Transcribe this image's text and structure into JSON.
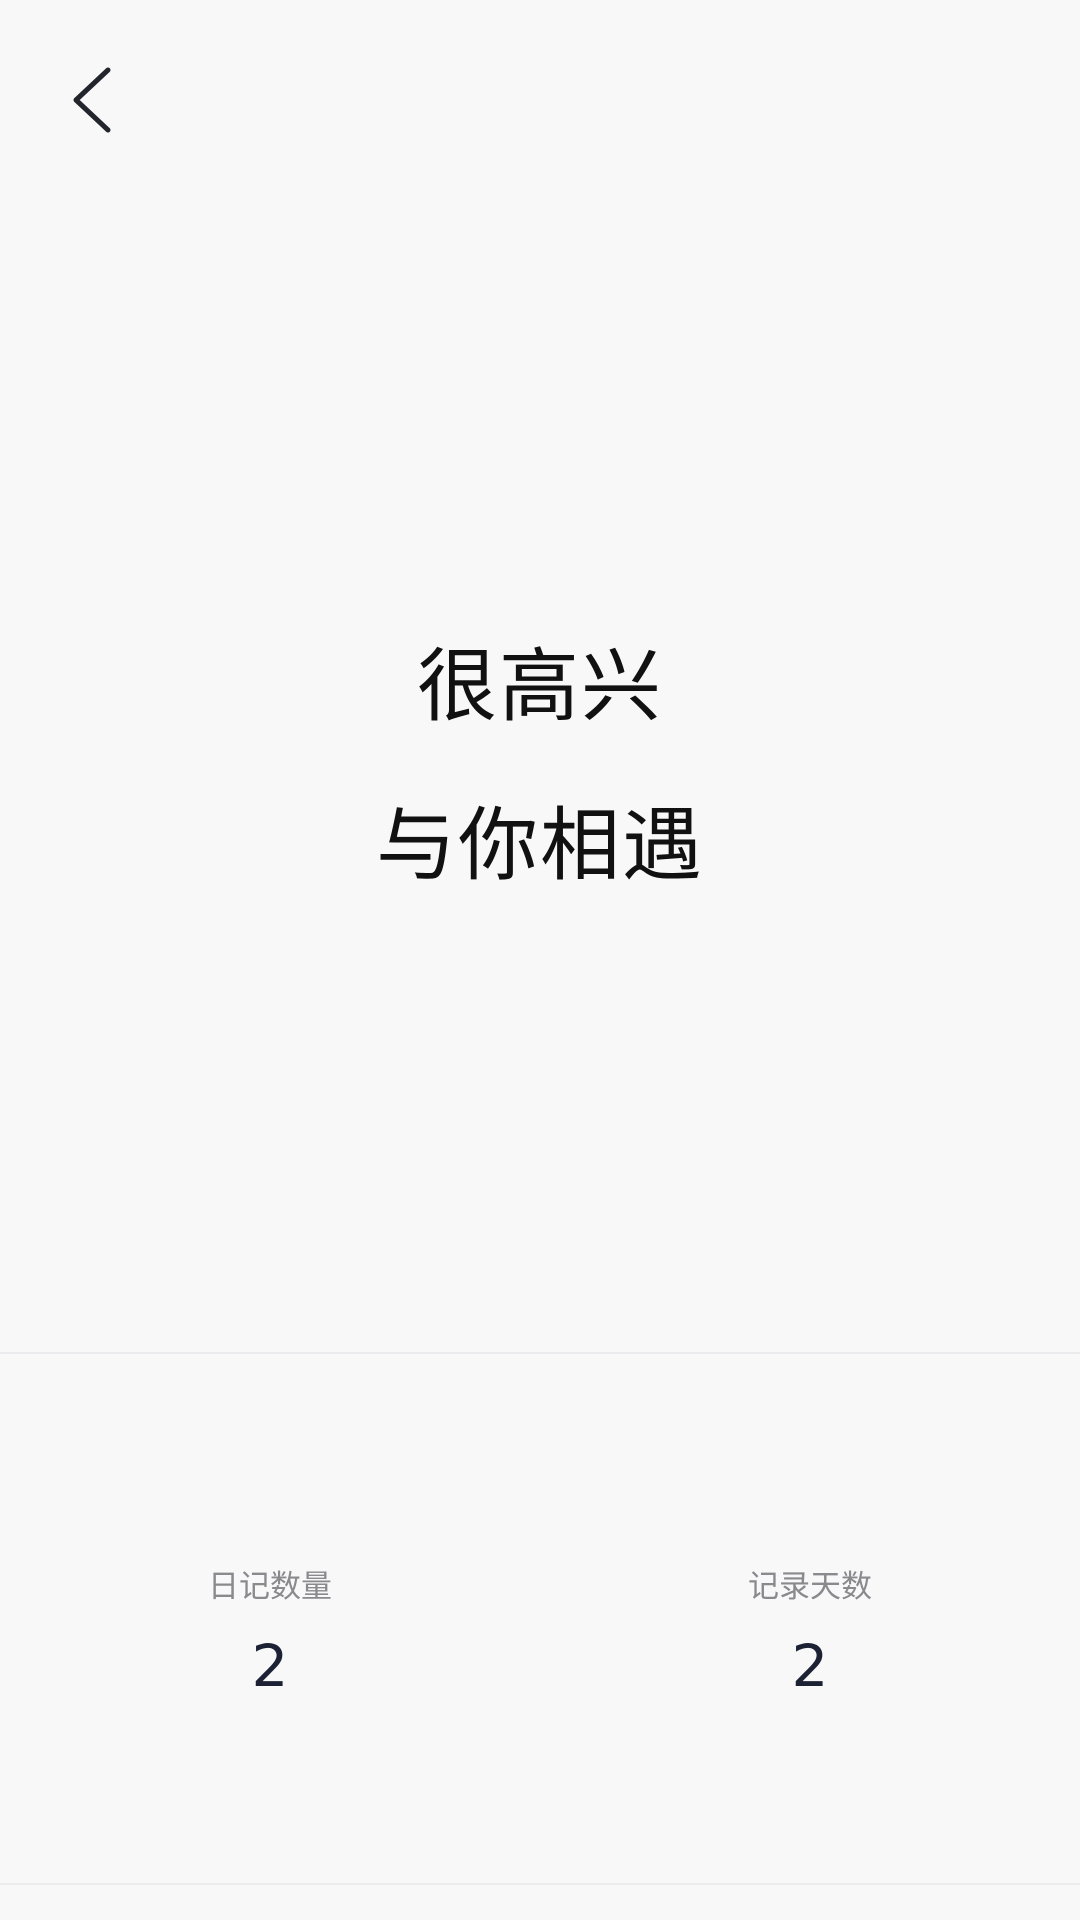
{
  "header": {
    "back_icon": "chevron-left-icon"
  },
  "greeting": {
    "line1": "很高兴",
    "line2": "与你相遇"
  },
  "stats": [
    {
      "label": "日记数量",
      "value": "2"
    },
    {
      "label": "记录天数",
      "value": "2"
    }
  ],
  "colors": {
    "background": "#f8f8f9",
    "greeting_text": "#111111",
    "stat_label": "#8a8a8e",
    "stat_value": "#1c2233",
    "divider": "#ececee"
  }
}
